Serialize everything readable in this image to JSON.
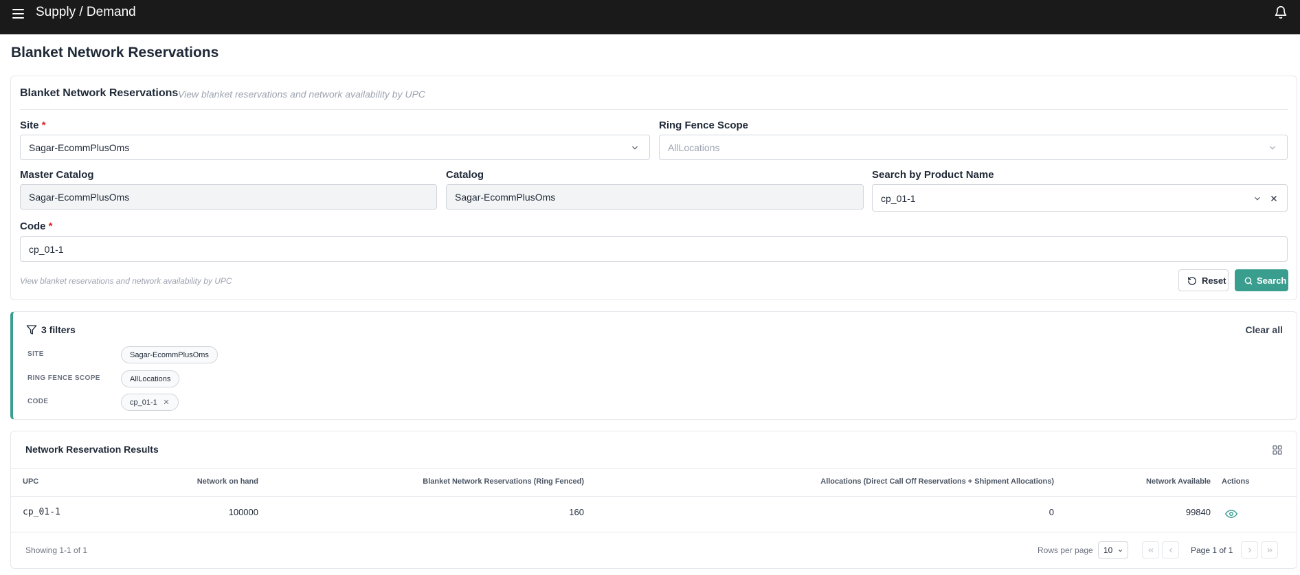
{
  "topbar": {
    "app_title": "Supply / Demand"
  },
  "page": {
    "title": "Blanket Network Reservations"
  },
  "form": {
    "header": "Blanket Network Reservations",
    "subheader": "View blanket reservations and network availability by UPC",
    "site_label": "Site",
    "site_value": "Sagar-EcommPlusOms",
    "scope_label": "Ring Fence Scope",
    "scope_value": "AllLocations",
    "master_catalog_label": "Master Catalog",
    "master_catalog_value": "Sagar-EcommPlusOms",
    "catalog_label": "Catalog",
    "catalog_value": "Sagar-EcommPlusOms",
    "product_search_label": "Search by Product Name",
    "product_search_value": "cp_01-1",
    "code_label": "Code",
    "code_value": "cp_01-1",
    "required_mark": "*",
    "hint": "View blanket reservations and network availability by UPC",
    "reset_label": "Reset",
    "search_label": "Search"
  },
  "filters": {
    "title": "3 filters",
    "clear_all": "Clear all",
    "rows": [
      {
        "label": "SITE",
        "value": "Sagar-EcommPlusOms"
      },
      {
        "label": "RING FENCE SCOPE",
        "value": "AllLocations"
      },
      {
        "label": "CODE",
        "value": "cp_01-1"
      }
    ]
  },
  "results": {
    "title": "Network Reservation Results",
    "columns": [
      "UPC",
      "Network on hand",
      "Blanket Network Reservations (Ring Fenced)",
      "Allocations (Direct Call Off Reservations + Shipment Allocations)",
      "Network Available",
      "Actions"
    ],
    "rows": [
      {
        "upc": "cp_01-1",
        "on_hand": "100000",
        "blanket": "160",
        "allocations": "0",
        "available": "99840",
        "action_icon": "eye-icon"
      }
    ],
    "showing": "Showing 1-1 of 1",
    "rows_per_page_label": "Rows per page",
    "rows_per_page_value": "10",
    "page_label": "Page 1 of 1"
  },
  "colors": {
    "topbar": "#1a1a1a",
    "accent": "#3a9e8f",
    "required": "#dc2626"
  }
}
